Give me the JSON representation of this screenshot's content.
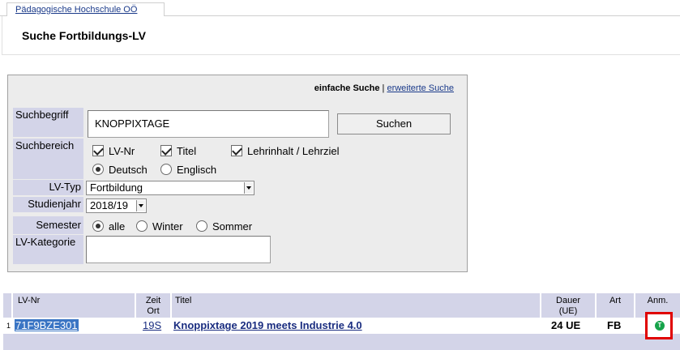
{
  "tab": {
    "label": "Pädagogische Hochschule OÖ"
  },
  "page": {
    "title": "Suche Fortbildungs-LV"
  },
  "search": {
    "mode_active": "einfache Suche",
    "separator": "|",
    "mode_link": "erweiterte Suche",
    "term_label": "Suchbegriff",
    "term_value": "KNOPPIXTAGE",
    "submit_label": "Suchen",
    "scope_label": "Suchbereich",
    "scope": {
      "lvnr": "LV-Nr",
      "titel": "Titel",
      "lehrinhalt": "Lehrinhalt / Lehrziel",
      "deutsch": "Deutsch",
      "englisch": "Englisch"
    },
    "lvtyp_label": "LV-Typ",
    "lvtyp_value": "Fortbildung",
    "studienjahr_label": "Studienjahr",
    "studienjahr_value": "2018/19",
    "semester_label": "Semester",
    "semester": {
      "alle": "alle",
      "winter": "Winter",
      "sommer": "Sommer"
    },
    "kategorie_label": "LV-Kategorie"
  },
  "table": {
    "headers": {
      "lvnr": "LV-Nr",
      "zeit": "Zeit",
      "ort": "Ort",
      "titel": "Titel",
      "dauer": "Dauer",
      "dauer_unit": "(UE)",
      "art": "Art",
      "anm": "Anm."
    },
    "rows": [
      {
        "num": "1",
        "lvnr": "71F9BZE301",
        "zeit_ort": "19S",
        "titel": "Knoppixtage 2019 meets Industrie 4.0",
        "dauer": "24 UE",
        "art": "FB",
        "anm_icon": "T"
      }
    ]
  }
}
